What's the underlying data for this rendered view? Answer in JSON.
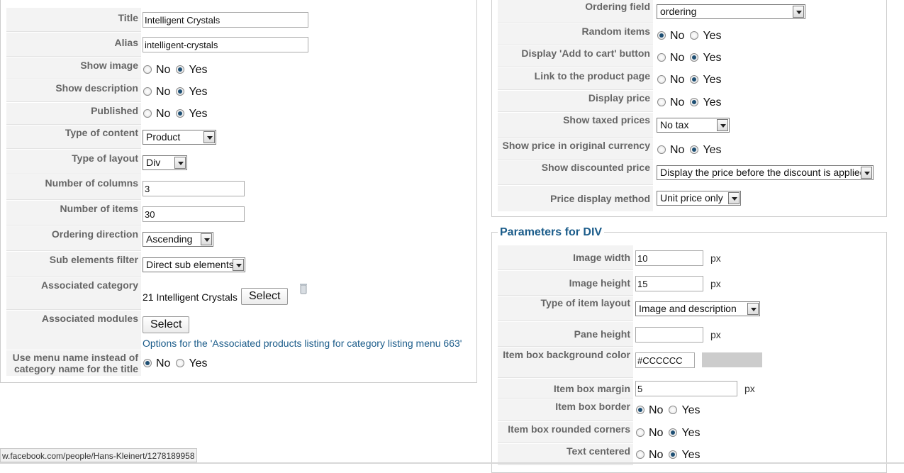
{
  "left": {
    "title_label": "Title",
    "title_value": "Intelligent Crystals",
    "alias_label": "Alias",
    "alias_value": "intelligent-crystals",
    "show_image_label": "Show image",
    "show_description_label": "Show description",
    "published_label": "Published",
    "type_of_content_label": "Type of content",
    "type_of_content_value": "Product",
    "type_of_layout_label": "Type of layout",
    "type_of_layout_value": "Div",
    "num_columns_label": "Number of columns",
    "num_columns_value": "3",
    "num_items_label": "Number of items",
    "num_items_value": "30",
    "ordering_direction_label": "Ordering direction",
    "ordering_direction_value": "Ascending",
    "sub_elements_label": "Sub elements filter",
    "sub_elements_value": "Direct sub elements",
    "assoc_category_label": "Associated category",
    "assoc_category_value": "21 Intelligent Crystals",
    "assoc_modules_label": "Associated modules",
    "options_link": "Options for the 'Associated products listing for category listing menu 663'",
    "use_menu_name_label_1": "Use menu name instead of",
    "use_menu_name_label_2": "category name for the title"
  },
  "right_top": {
    "ordering_field_label": "Ordering field",
    "ordering_field_value": "ordering",
    "random_items_label": "Random items",
    "add_to_cart_label": "Display 'Add to cart' button",
    "link_product_label": "Link to the product page",
    "display_price_label": "Display price",
    "show_taxed_label": "Show taxed prices",
    "show_taxed_value": "No tax",
    "orig_currency_label": "Show price in original currency",
    "discounted_label": "Show discounted price",
    "discounted_value": "Display the price before the discount is applied",
    "price_method_label": "Price display method",
    "price_method_value": "Unit price only"
  },
  "right_bottom": {
    "legend": "Parameters for DIV",
    "image_width_label": "Image width",
    "image_width_value": "10",
    "image_height_label": "Image height",
    "image_height_value": "15",
    "item_layout_label": "Type of item layout",
    "item_layout_value": "Image and description",
    "pane_height_label": "Pane height",
    "pane_height_value": "",
    "bg_color_label": "Item box background color",
    "bg_color_value": "#CCCCCC",
    "margin_label": "Item box margin",
    "margin_value": "5",
    "border_label": "Item box border",
    "rounded_label": "Item box rounded corners",
    "centered_label": "Text centered"
  },
  "common": {
    "no": "No",
    "yes": "Yes",
    "select": "Select",
    "px": "px"
  },
  "status_bar": "w.facebook.com/people/Hans-Kleinert/1278189958",
  "colors": {
    "swatch": "#CCCCCC",
    "label_bg": "#f3f3f3",
    "link": "#1b5c8a",
    "radio_dot": "#1e4f73"
  }
}
